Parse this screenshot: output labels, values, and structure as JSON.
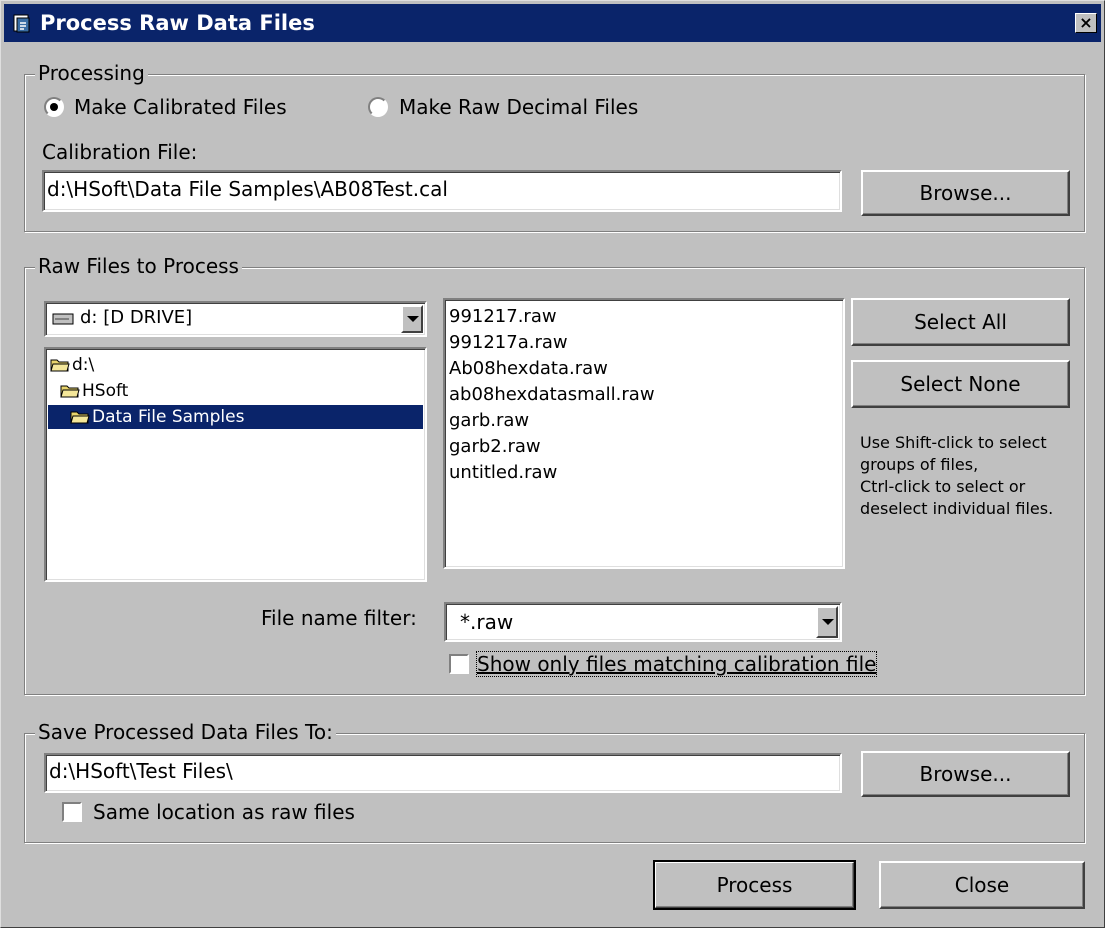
{
  "window": {
    "title": "Process Raw Data Files",
    "close_glyph": "×"
  },
  "processing": {
    "legend": "Processing",
    "radio_calibrated": "Make Calibrated Files",
    "radio_raw_decimal": "Make Raw Decimal Files",
    "selected": "calibrated",
    "calibration_label": "Calibration File:",
    "calibration_value": "d:\\HSoft\\Data File Samples\\AB08Test.cal",
    "browse_label": "Browse..."
  },
  "raw_files": {
    "legend": "Raw Files to Process",
    "drive": "d: [D DRIVE]",
    "folders": [
      {
        "label": "d:\\",
        "selected": false
      },
      {
        "label": "HSoft",
        "selected": false
      },
      {
        "label": "Data File Samples",
        "selected": true
      }
    ],
    "files": [
      "991217.raw",
      "991217a.raw",
      "Ab08hexdata.raw",
      "ab08hexdatasmall.raw",
      "garb.raw",
      "garb2.raw",
      "untitled.raw"
    ],
    "select_all_label": "Select All",
    "select_none_label": "Select None",
    "help_lines": [
      "Use Shift-click to select",
      "groups of files,",
      "Ctrl-click to select or",
      "deselect individual files."
    ],
    "filter_label": "File name filter:",
    "filter_value": "*.raw",
    "show_matching_label": "Show only files matching calibration file",
    "show_matching_checked": false
  },
  "save": {
    "legend": "Save Processed Data Files To:",
    "path_value": "d:\\HSoft\\Test Files\\",
    "browse_label": "Browse...",
    "same_location_label": "Same location as raw files",
    "same_location_checked": false
  },
  "footer": {
    "process_label": "Process",
    "close_label": "Close"
  },
  "colors": {
    "title_bar": "#0a246a",
    "face": "#c0c0c0",
    "selection": "#0a246a",
    "folder": "#e8d46c"
  }
}
